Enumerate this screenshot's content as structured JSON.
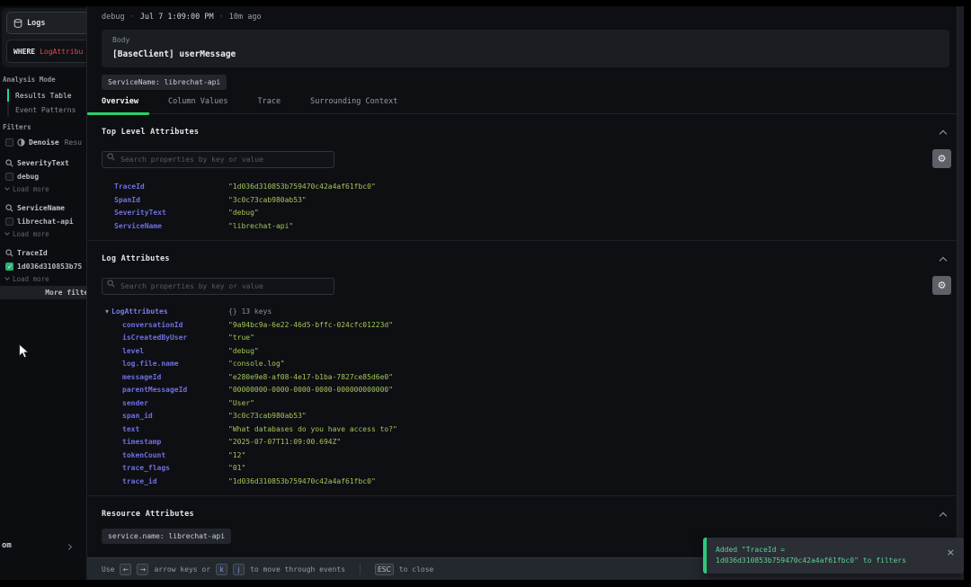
{
  "colors": {
    "accent_green": "#2ad06b",
    "active_teal": "#27d3a2",
    "toast_green": "#5ed095",
    "key_purple": "#6f6fe0",
    "value_green": "#a4c65a",
    "query_red": "#e5484d",
    "checkbox_teal": "#27b173"
  },
  "sidebar": {
    "logs_button": "Logs",
    "where_label": "WHERE",
    "where_query": "LogAttribu",
    "analysis_mode_label": "Analysis Mode",
    "modes": [
      {
        "label": "Results Table",
        "active": true
      },
      {
        "label": "Event Patterns",
        "active": false
      }
    ],
    "filters_label": "Filters",
    "denoise": {
      "strong": "Denoise",
      "rest": "Resu"
    },
    "filter_groups": [
      {
        "name": "SeverityText",
        "option": "debug",
        "checked": false,
        "load_more": "Load more"
      },
      {
        "name": "ServiceName",
        "option": "librechat-api",
        "checked": false,
        "load_more": "Load more"
      },
      {
        "name": "TraceId",
        "option": "1d036d310853b75",
        "checked": true,
        "load_more": "Load more"
      }
    ],
    "more_filters_label": "More filters",
    "corner_text": "om"
  },
  "drawer": {
    "header": {
      "severity": "debug",
      "separator": "·",
      "datetime": "Jul 7 1:09:00 PM",
      "ago": "10m ago"
    },
    "body_panel": {
      "label": "Body",
      "content": "[BaseClient] userMessage"
    },
    "service_chip": "ServiceName: librechat-api",
    "tabs": [
      {
        "label": "Overview",
        "active": true
      },
      {
        "label": "Column Values",
        "active": false
      },
      {
        "label": "Trace",
        "active": false
      },
      {
        "label": "Surrounding Context",
        "active": false
      }
    ],
    "top_level": {
      "title": "Top Level Attributes",
      "search_placeholder": "Search properties by key or value",
      "rows": [
        {
          "key": "TraceId",
          "value": "\"1d036d310853b759470c42a4af61fbc0\""
        },
        {
          "key": "SpanId",
          "value": "\"3c0c73cab980ab53\""
        },
        {
          "key": "SeverityText",
          "value": "\"debug\""
        },
        {
          "key": "ServiceName",
          "value": "\"librechat-api\""
        }
      ]
    },
    "log_attributes": {
      "title": "Log Attributes",
      "search_placeholder": "Search properties by key or value",
      "root_key": "LogAttributes",
      "root_meta": "{} 13 keys",
      "rows": [
        {
          "key": "conversationId",
          "value": "\"9a94bc9a-6e22-46d5-bffc-024cfc01223d\""
        },
        {
          "key": "isCreatedByUser",
          "value": "\"true\""
        },
        {
          "key": "level",
          "value": "\"debug\""
        },
        {
          "key": "log.file.name",
          "value": "\"console.log\""
        },
        {
          "key": "messageId",
          "value": "\"e280e9e8-af08-4e17-b1ba-7827ce85d6e0\""
        },
        {
          "key": "parentMessageId",
          "value": "\"00000000-0000-0000-0000-000000000000\""
        },
        {
          "key": "sender",
          "value": "\"User\""
        },
        {
          "key": "span_id",
          "value": "\"3c0c73cab980ab53\""
        },
        {
          "key": "text",
          "value": "\"What databases do you have access to?\""
        },
        {
          "key": "timestamp",
          "value": "\"2025-07-07T11:09:00.694Z\""
        },
        {
          "key": "tokenCount",
          "value": "\"12\""
        },
        {
          "key": "trace_flags",
          "value": "\"01\""
        },
        {
          "key": "trace_id",
          "value": "\"1d036d310853b759470c42a4af61fbc0\""
        }
      ]
    },
    "resource": {
      "title": "Resource Attributes",
      "chip": "service.name: librechat-api"
    },
    "footer": {
      "prefix": "Use",
      "key_left": "←",
      "key_right": "→",
      "mid": "arrow keys or",
      "key_k": "k",
      "key_j": "j",
      "move_text": "to move through events",
      "esc_key": "ESC",
      "close_text": "to close"
    }
  },
  "toast": {
    "line1": "Added \"TraceId =",
    "line2": "1d036d310853b759470c42a4af61fbc0\" to filters",
    "close": "×"
  }
}
